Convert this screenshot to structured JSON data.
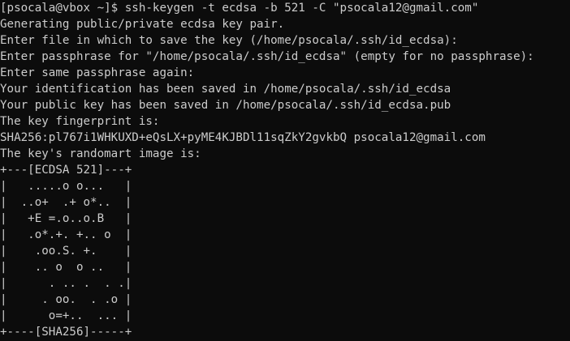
{
  "terminal": {
    "prompt": "[psocala@vbox ~]$ ",
    "command": "ssh-keygen -t ecdsa -b 521 -C \"psocala12@gmail.com\"",
    "output": [
      "Generating public/private ecdsa key pair.",
      "Enter file in which to save the key (/home/psocala/.ssh/id_ecdsa):",
      "Enter passphrase for \"/home/psocala/.ssh/id_ecdsa\" (empty for no passphrase):",
      "Enter same passphrase again:",
      "Your identification has been saved in /home/psocala/.ssh/id_ecdsa",
      "Your public key has been saved in /home/psocala/.ssh/id_ecdsa.pub",
      "The key fingerprint is:",
      "SHA256:pl767i1WHKUXD+eQsLX+pyME4KJBDl11sqZkY2gvkbQ psocala12@gmail.com",
      "The key's randomart image is:",
      "+---[ECDSA 521]---+",
      "|   .....o o...   |",
      "|  ..o+  .+ o*..  |",
      "|   +E =.o..o.B   |",
      "|   .o*.+. +.. o  |",
      "|    .oo.S. +.    |",
      "|    .. o  o ..   |",
      "|      . .. .  . .|",
      "|     . oo.  . .o |",
      "|      o=+..  ... |",
      "+----[SHA256]-----+"
    ]
  }
}
